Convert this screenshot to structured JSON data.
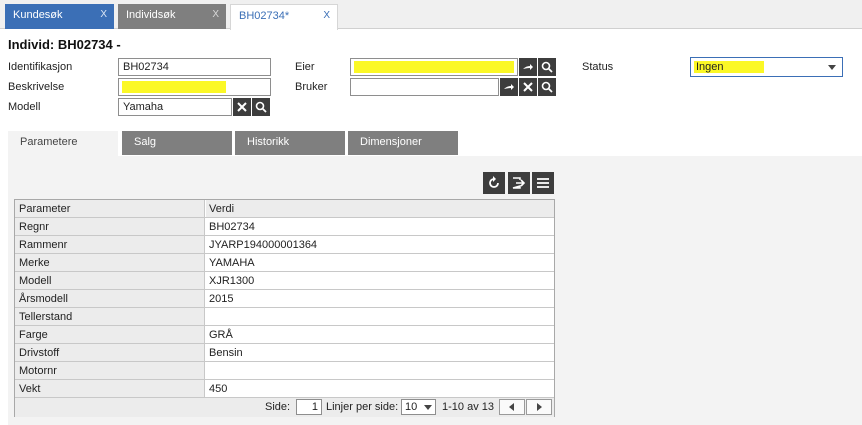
{
  "tabs": [
    {
      "label": "Kundesøk",
      "close": "X"
    },
    {
      "label": "Individsøk",
      "close": "X"
    },
    {
      "label": "BH02734*",
      "close": "X"
    }
  ],
  "page_title": "Individ: BH02734 -",
  "form": {
    "identifikasjon_label": "Identifikasjon",
    "identifikasjon_value": "BH02734",
    "beskrivelse_label": "Beskrivelse",
    "beskrivelse_value": "",
    "modell_label": "Modell",
    "modell_value": "Yamaha",
    "eier_label": "Eier",
    "eier_value": "",
    "bruker_label": "Bruker",
    "bruker_value": "",
    "status_label": "Status",
    "status_value": "Ingen"
  },
  "subtabs": [
    "Parametere",
    "Salg",
    "Historikk",
    "Dimensjoner"
  ],
  "toolbar_icons": [
    "refresh-icon",
    "export-icon",
    "menu-icon"
  ],
  "grid": {
    "headers": [
      "Parameter",
      "Verdi"
    ],
    "rows": [
      [
        "Regnr",
        "BH02734"
      ],
      [
        "Rammenr",
        "JYARP194000001364"
      ],
      [
        "Merke",
        "YAMAHA"
      ],
      [
        "Modell",
        "XJR1300"
      ],
      [
        "Årsmodell",
        "2015"
      ],
      [
        "Tellerstand",
        ""
      ],
      [
        "Farge",
        "GRÅ"
      ],
      [
        "Drivstoff",
        "Bensin"
      ],
      [
        "Motornr",
        ""
      ],
      [
        "Vekt",
        "450"
      ]
    ]
  },
  "pager": {
    "side_label": "Side:",
    "page": "1",
    "lines_label": "Linjer per side:",
    "lines_value": "10",
    "range": "1-10 av 13"
  },
  "colors": {
    "accent": "#3b6fb6",
    "highlight": "#fbf826",
    "dark_button": "#3d3d3d",
    "inactive_tab": "#7f7f7f"
  }
}
